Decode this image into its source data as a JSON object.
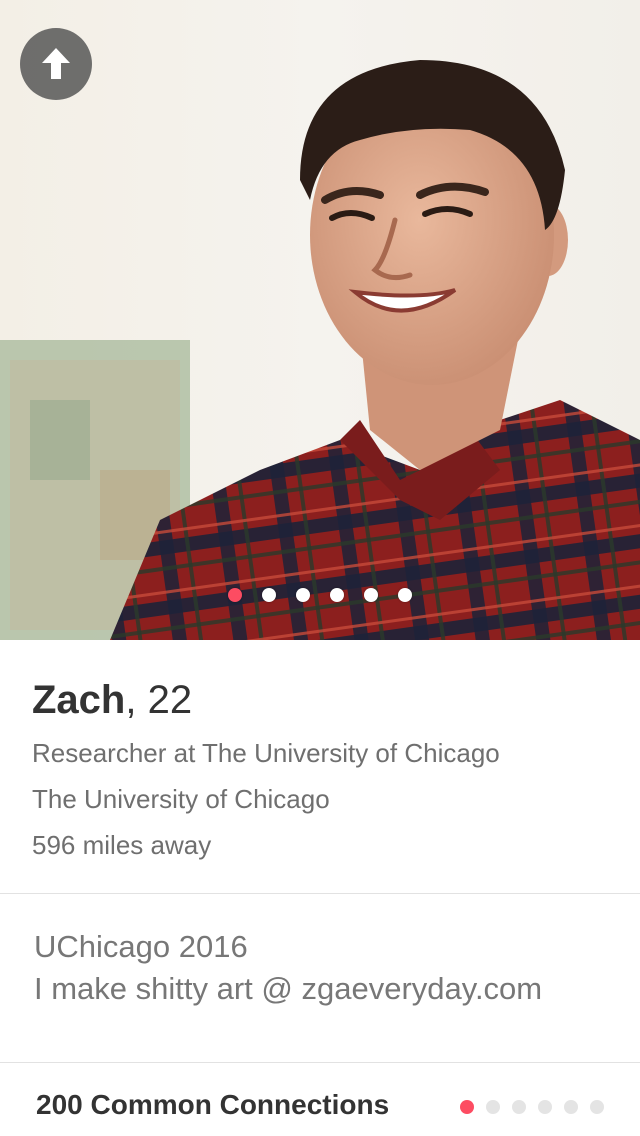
{
  "colors": {
    "accent": "#fd4c62",
    "text_dark": "#333333",
    "text_muted": "#6f6f6f"
  },
  "photo": {
    "alt": "profile-photo",
    "page_count": 6,
    "active_index": 0,
    "back_icon": "arrow-up-icon"
  },
  "profile": {
    "name": "Zach",
    "separator": ",",
    "age": "22",
    "job": "Researcher at The University of Chicago",
    "school": "The University of Chicago",
    "distance": "596 miles away"
  },
  "bio": {
    "lines": [
      "UChicago 2016",
      "I make shitty art @ zgaeveryday.com"
    ]
  },
  "connections": {
    "label": "200 Common Connections",
    "page_count": 6,
    "active_index": 0
  }
}
